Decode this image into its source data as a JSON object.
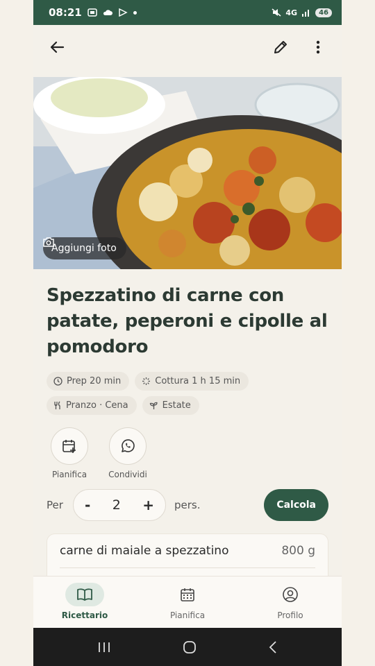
{
  "status_bar": {
    "time": "08:21",
    "network": "4G",
    "battery": "46"
  },
  "hero": {
    "add_photo_label": "Aggiungi foto"
  },
  "recipe": {
    "title": "Spezzatino di carne con patate, peperoni e cipolle al pomodoro",
    "prep": "Prep 20 min",
    "cook": "Cottura 1 h 15 min",
    "meal": "Pranzo · Cena",
    "season": "Estate"
  },
  "actions": {
    "plan": "Pianifica",
    "share": "Condividi"
  },
  "servings": {
    "per": "Per",
    "value": "2",
    "minus": "-",
    "plus": "+",
    "unit": "pers.",
    "calc": "Calcola"
  },
  "ingredients": [
    {
      "name": "carne di maiale a spezzatino",
      "qty": "800 g"
    }
  ],
  "bottom_nav": [
    {
      "label": "Ricettario",
      "icon": "book-icon",
      "active": true
    },
    {
      "label": "Pianifica",
      "icon": "calendar-icon",
      "active": false
    },
    {
      "label": "Profilo",
      "icon": "profile-icon",
      "active": false
    }
  ],
  "colors": {
    "primary": "#2f5a46",
    "background": "#f4f1ea",
    "chip": "#ebe7df"
  }
}
